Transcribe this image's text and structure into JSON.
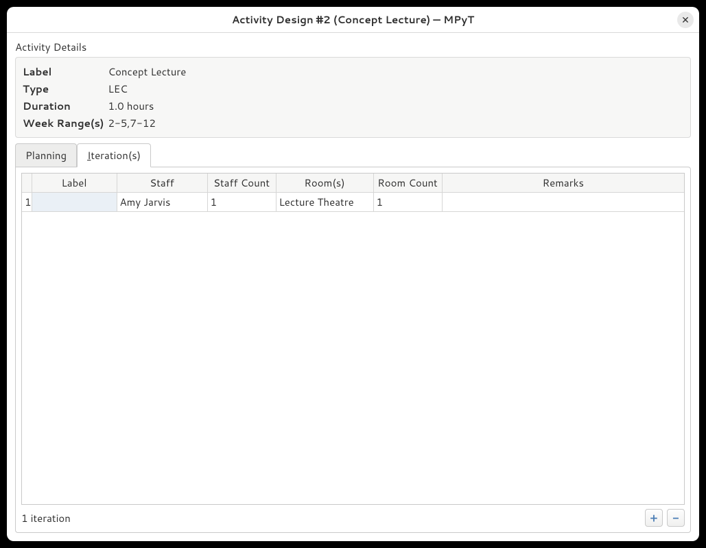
{
  "window": {
    "title": "Activity Design #2 (Concept Lecture) — MPyT",
    "close": "✕"
  },
  "details": {
    "section_label": "Activity Details",
    "rows": {
      "label_k": "Label",
      "label_v": "Concept Lecture",
      "type_k": "Type",
      "type_v": "LEC",
      "duration_k": "Duration",
      "duration_v": "1.0 hours",
      "weeks_k": "Week Range(s)",
      "weeks_v": "2-5,7-12"
    }
  },
  "tabs": {
    "planning": "Planning",
    "iterations_prefix": "I",
    "iterations_rest": "teration(s)"
  },
  "table": {
    "headers": {
      "rownum": "",
      "label": "Label",
      "staff": "Staff",
      "staff_count": "Staff Count",
      "rooms": "Room(s)",
      "room_count": "Room Count",
      "remarks": "Remarks"
    },
    "rows": [
      {
        "n": "1",
        "label": "",
        "staff": "Amy Jarvis",
        "staff_count": "1",
        "rooms": "Lecture Theatre",
        "room_count": "1",
        "remarks": ""
      }
    ]
  },
  "footer": {
    "status": "1 iteration",
    "add": "+",
    "remove": "−"
  }
}
